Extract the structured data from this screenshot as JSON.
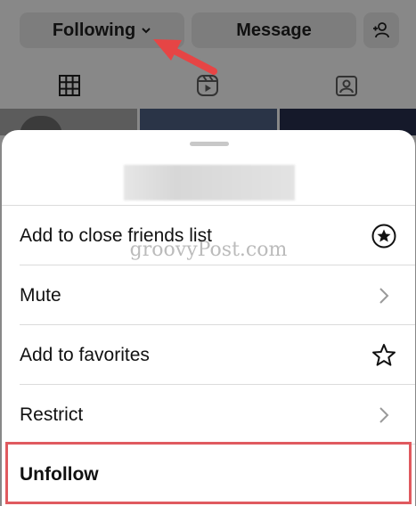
{
  "profile_actions": {
    "following_label": "Following",
    "message_label": "Message"
  },
  "tabs": [
    "grid-icon",
    "reels-icon",
    "tagged-icon"
  ],
  "sheet": {
    "menu": [
      {
        "label": "Add to close friends list",
        "icon": "close-friends-star-icon"
      },
      {
        "label": "Mute",
        "icon": "chevron-right-icon"
      },
      {
        "label": "Add to favorites",
        "icon": "star-outline-icon"
      },
      {
        "label": "Restrict",
        "icon": "chevron-right-icon"
      },
      {
        "label": "Unfollow",
        "icon": ""
      }
    ]
  },
  "watermark": "groovyPost.com",
  "colors": {
    "highlight": "#e05a5f",
    "arrow": "#e64545"
  }
}
